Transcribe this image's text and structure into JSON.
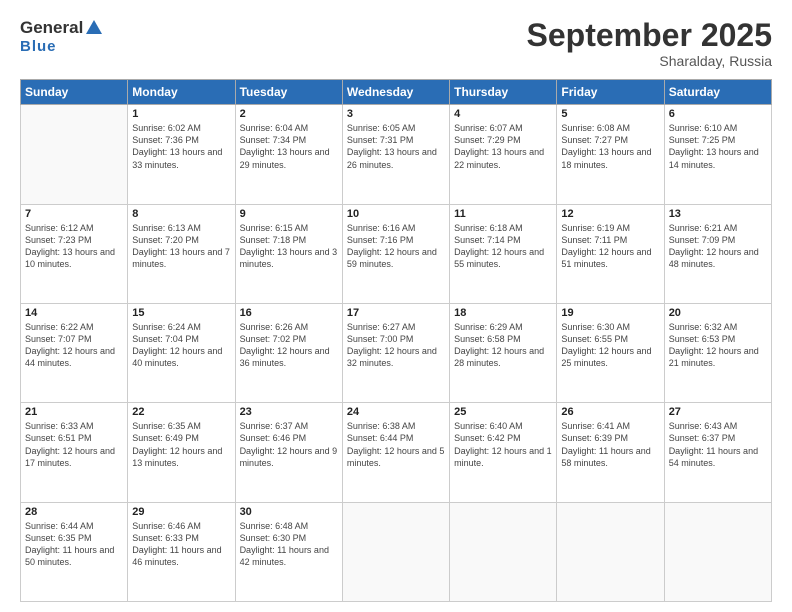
{
  "header": {
    "logo_general": "General",
    "logo_blue": "Blue",
    "month": "September 2025",
    "location": "Sharalday, Russia"
  },
  "weekdays": [
    "Sunday",
    "Monday",
    "Tuesday",
    "Wednesday",
    "Thursday",
    "Friday",
    "Saturday"
  ],
  "weeks": [
    [
      {
        "day": "",
        "sunrise": "",
        "sunset": "",
        "daylight": ""
      },
      {
        "day": "1",
        "sunrise": "Sunrise: 6:02 AM",
        "sunset": "Sunset: 7:36 PM",
        "daylight": "Daylight: 13 hours and 33 minutes."
      },
      {
        "day": "2",
        "sunrise": "Sunrise: 6:04 AM",
        "sunset": "Sunset: 7:34 PM",
        "daylight": "Daylight: 13 hours and 29 minutes."
      },
      {
        "day": "3",
        "sunrise": "Sunrise: 6:05 AM",
        "sunset": "Sunset: 7:31 PM",
        "daylight": "Daylight: 13 hours and 26 minutes."
      },
      {
        "day": "4",
        "sunrise": "Sunrise: 6:07 AM",
        "sunset": "Sunset: 7:29 PM",
        "daylight": "Daylight: 13 hours and 22 minutes."
      },
      {
        "day": "5",
        "sunrise": "Sunrise: 6:08 AM",
        "sunset": "Sunset: 7:27 PM",
        "daylight": "Daylight: 13 hours and 18 minutes."
      },
      {
        "day": "6",
        "sunrise": "Sunrise: 6:10 AM",
        "sunset": "Sunset: 7:25 PM",
        "daylight": "Daylight: 13 hours and 14 minutes."
      }
    ],
    [
      {
        "day": "7",
        "sunrise": "Sunrise: 6:12 AM",
        "sunset": "Sunset: 7:23 PM",
        "daylight": "Daylight: 13 hours and 10 minutes."
      },
      {
        "day": "8",
        "sunrise": "Sunrise: 6:13 AM",
        "sunset": "Sunset: 7:20 PM",
        "daylight": "Daylight: 13 hours and 7 minutes."
      },
      {
        "day": "9",
        "sunrise": "Sunrise: 6:15 AM",
        "sunset": "Sunset: 7:18 PM",
        "daylight": "Daylight: 13 hours and 3 minutes."
      },
      {
        "day": "10",
        "sunrise": "Sunrise: 6:16 AM",
        "sunset": "Sunset: 7:16 PM",
        "daylight": "Daylight: 12 hours and 59 minutes."
      },
      {
        "day": "11",
        "sunrise": "Sunrise: 6:18 AM",
        "sunset": "Sunset: 7:14 PM",
        "daylight": "Daylight: 12 hours and 55 minutes."
      },
      {
        "day": "12",
        "sunrise": "Sunrise: 6:19 AM",
        "sunset": "Sunset: 7:11 PM",
        "daylight": "Daylight: 12 hours and 51 minutes."
      },
      {
        "day": "13",
        "sunrise": "Sunrise: 6:21 AM",
        "sunset": "Sunset: 7:09 PM",
        "daylight": "Daylight: 12 hours and 48 minutes."
      }
    ],
    [
      {
        "day": "14",
        "sunrise": "Sunrise: 6:22 AM",
        "sunset": "Sunset: 7:07 PM",
        "daylight": "Daylight: 12 hours and 44 minutes."
      },
      {
        "day": "15",
        "sunrise": "Sunrise: 6:24 AM",
        "sunset": "Sunset: 7:04 PM",
        "daylight": "Daylight: 12 hours and 40 minutes."
      },
      {
        "day": "16",
        "sunrise": "Sunrise: 6:26 AM",
        "sunset": "Sunset: 7:02 PM",
        "daylight": "Daylight: 12 hours and 36 minutes."
      },
      {
        "day": "17",
        "sunrise": "Sunrise: 6:27 AM",
        "sunset": "Sunset: 7:00 PM",
        "daylight": "Daylight: 12 hours and 32 minutes."
      },
      {
        "day": "18",
        "sunrise": "Sunrise: 6:29 AM",
        "sunset": "Sunset: 6:58 PM",
        "daylight": "Daylight: 12 hours and 28 minutes."
      },
      {
        "day": "19",
        "sunrise": "Sunrise: 6:30 AM",
        "sunset": "Sunset: 6:55 PM",
        "daylight": "Daylight: 12 hours and 25 minutes."
      },
      {
        "day": "20",
        "sunrise": "Sunrise: 6:32 AM",
        "sunset": "Sunset: 6:53 PM",
        "daylight": "Daylight: 12 hours and 21 minutes."
      }
    ],
    [
      {
        "day": "21",
        "sunrise": "Sunrise: 6:33 AM",
        "sunset": "Sunset: 6:51 PM",
        "daylight": "Daylight: 12 hours and 17 minutes."
      },
      {
        "day": "22",
        "sunrise": "Sunrise: 6:35 AM",
        "sunset": "Sunset: 6:49 PM",
        "daylight": "Daylight: 12 hours and 13 minutes."
      },
      {
        "day": "23",
        "sunrise": "Sunrise: 6:37 AM",
        "sunset": "Sunset: 6:46 PM",
        "daylight": "Daylight: 12 hours and 9 minutes."
      },
      {
        "day": "24",
        "sunrise": "Sunrise: 6:38 AM",
        "sunset": "Sunset: 6:44 PM",
        "daylight": "Daylight: 12 hours and 5 minutes."
      },
      {
        "day": "25",
        "sunrise": "Sunrise: 6:40 AM",
        "sunset": "Sunset: 6:42 PM",
        "daylight": "Daylight: 12 hours and 1 minute."
      },
      {
        "day": "26",
        "sunrise": "Sunrise: 6:41 AM",
        "sunset": "Sunset: 6:39 PM",
        "daylight": "Daylight: 11 hours and 58 minutes."
      },
      {
        "day": "27",
        "sunrise": "Sunrise: 6:43 AM",
        "sunset": "Sunset: 6:37 PM",
        "daylight": "Daylight: 11 hours and 54 minutes."
      }
    ],
    [
      {
        "day": "28",
        "sunrise": "Sunrise: 6:44 AM",
        "sunset": "Sunset: 6:35 PM",
        "daylight": "Daylight: 11 hours and 50 minutes."
      },
      {
        "day": "29",
        "sunrise": "Sunrise: 6:46 AM",
        "sunset": "Sunset: 6:33 PM",
        "daylight": "Daylight: 11 hours and 46 minutes."
      },
      {
        "day": "30",
        "sunrise": "Sunrise: 6:48 AM",
        "sunset": "Sunset: 6:30 PM",
        "daylight": "Daylight: 11 hours and 42 minutes."
      },
      {
        "day": "",
        "sunrise": "",
        "sunset": "",
        "daylight": ""
      },
      {
        "day": "",
        "sunrise": "",
        "sunset": "",
        "daylight": ""
      },
      {
        "day": "",
        "sunrise": "",
        "sunset": "",
        "daylight": ""
      },
      {
        "day": "",
        "sunrise": "",
        "sunset": "",
        "daylight": ""
      }
    ]
  ]
}
